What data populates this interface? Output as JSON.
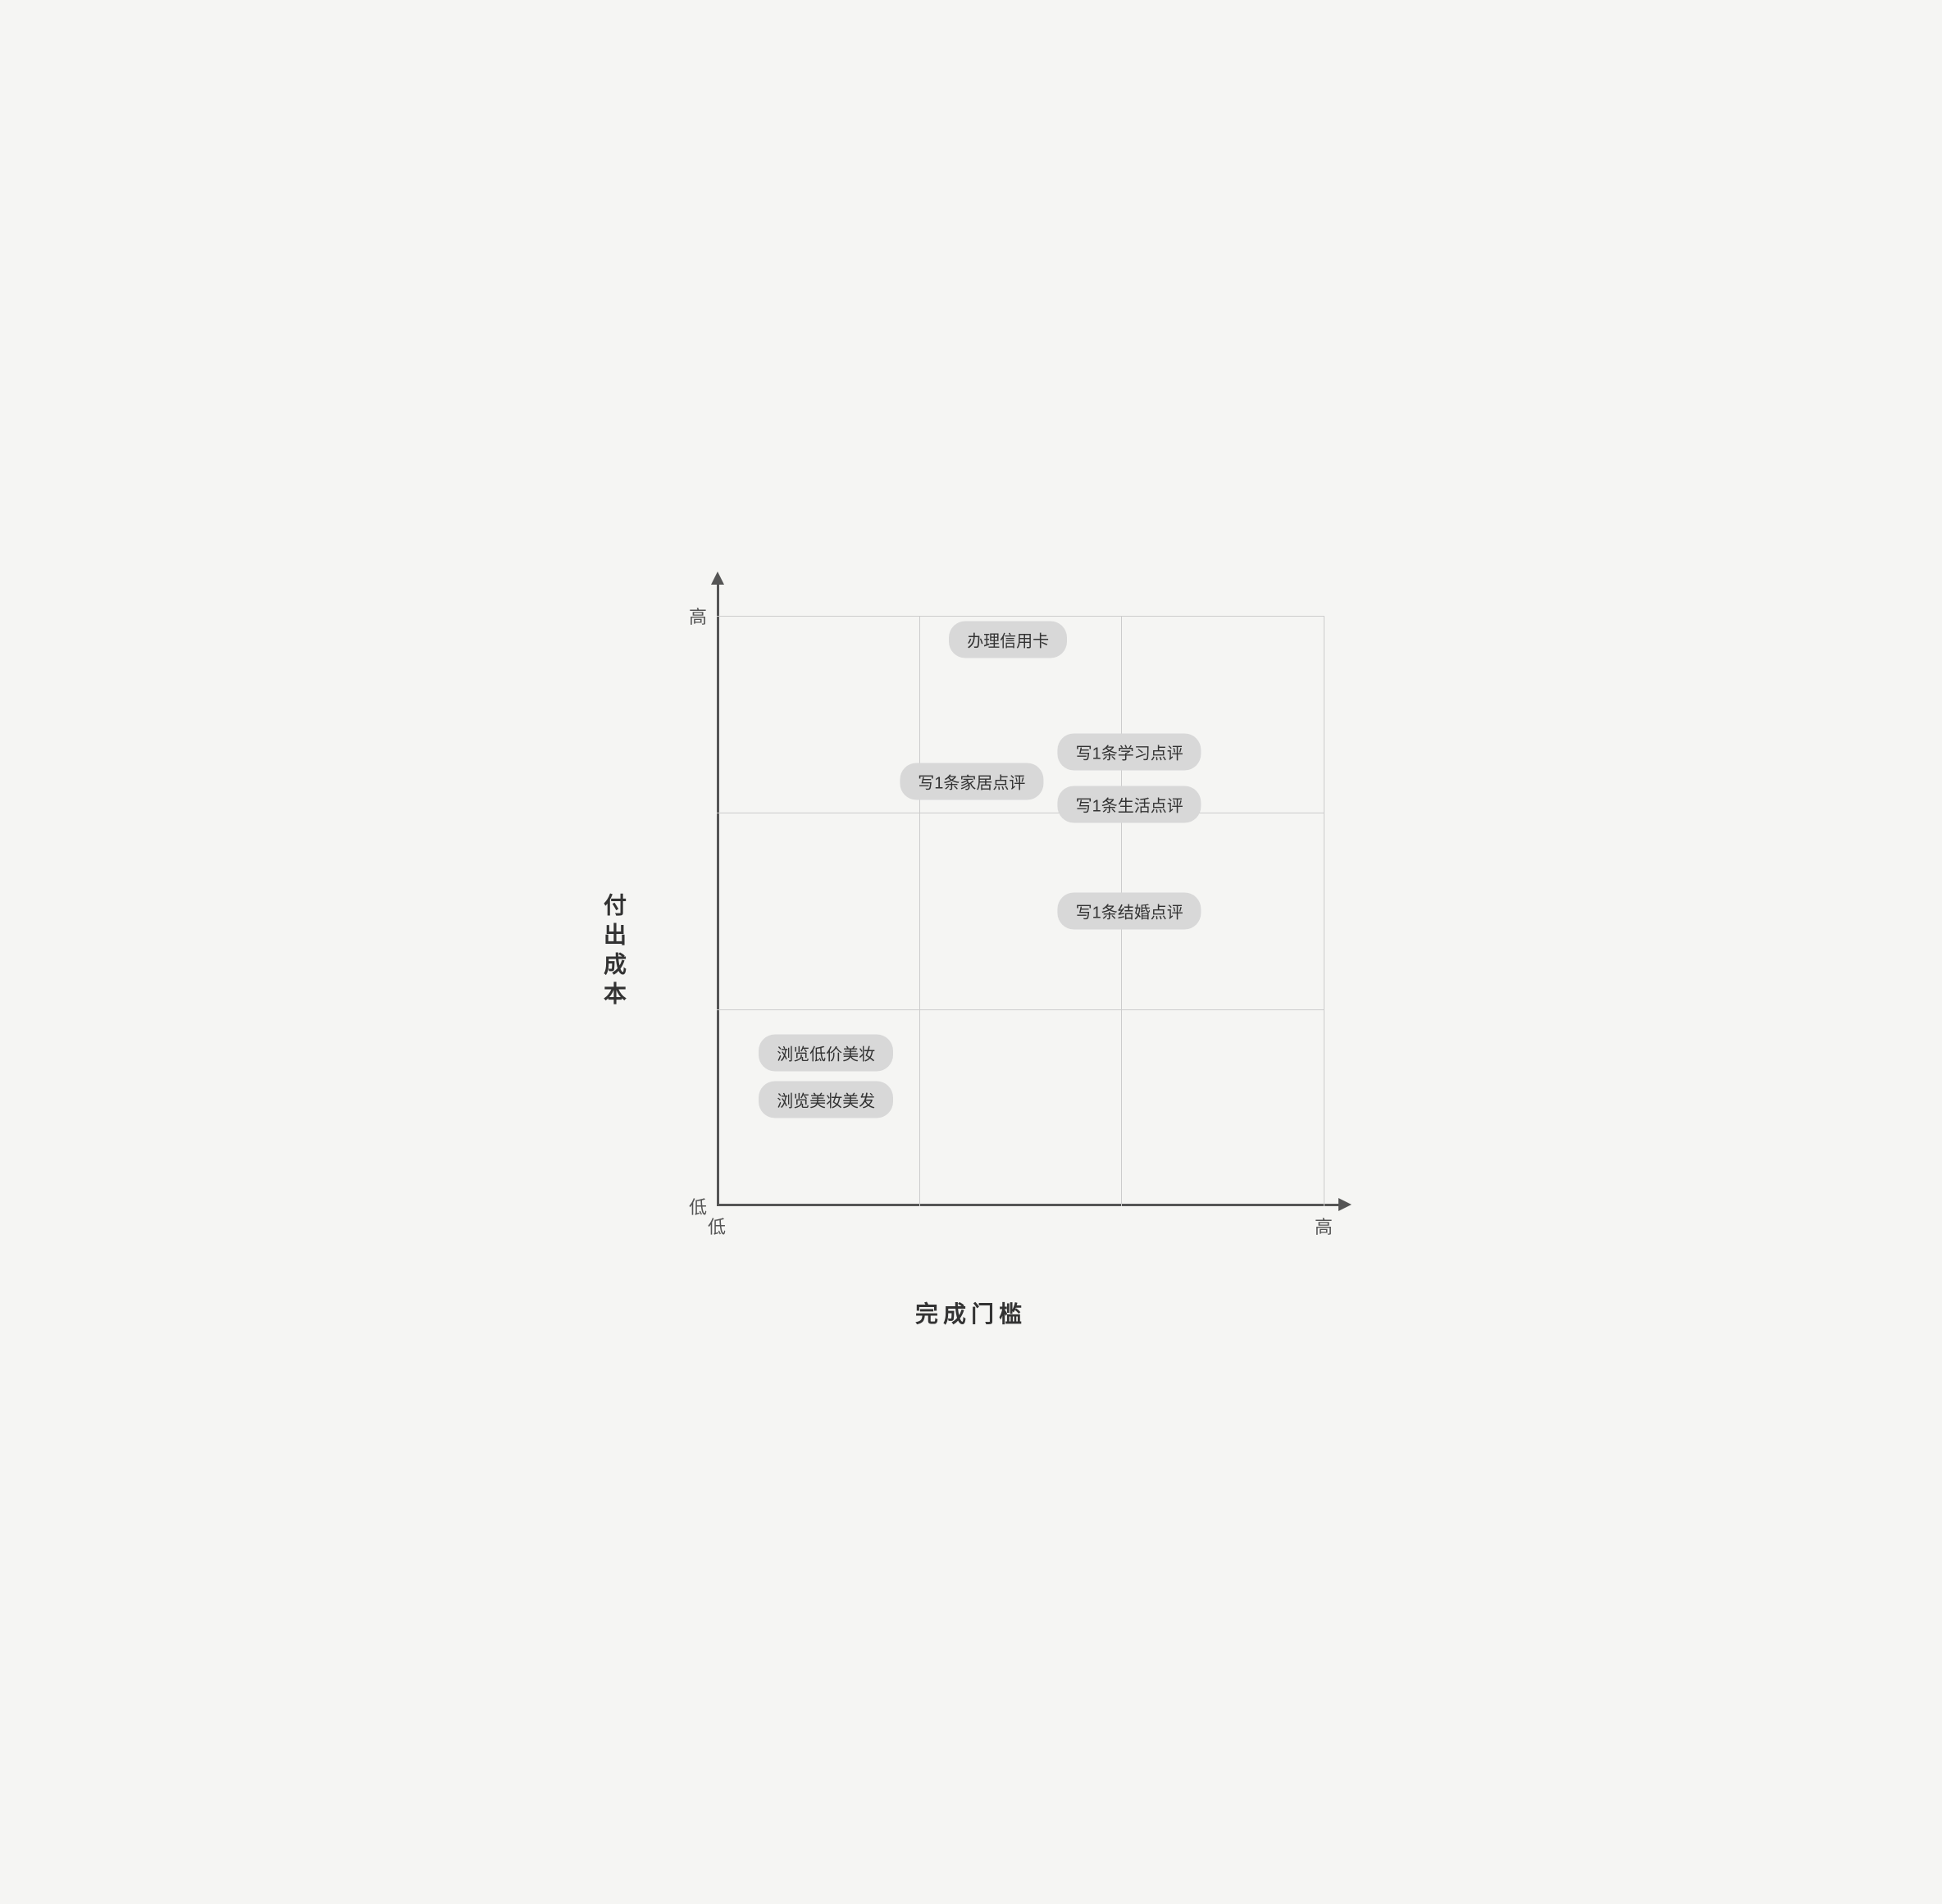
{
  "chart": {
    "y_axis_label": "付出成本",
    "x_axis_label": "完成门槛",
    "label_high_y": "高",
    "label_low_y": "低",
    "label_low_x": "低",
    "label_high_x": "高",
    "tags": [
      {
        "id": "tag-credit-card",
        "text": "办理信用卡",
        "x_pct": 48,
        "y_pct": 96
      },
      {
        "id": "tag-home-review",
        "text": "写1条家居点评",
        "x_pct": 42,
        "y_pct": 72
      },
      {
        "id": "tag-study-review",
        "text": "写1条学习点评",
        "x_pct": 68,
        "y_pct": 77
      },
      {
        "id": "tag-life-review",
        "text": "写1条生活点评",
        "x_pct": 68,
        "y_pct": 68
      },
      {
        "id": "tag-wedding-review",
        "text": "写1条结婚点评",
        "x_pct": 68,
        "y_pct": 50
      },
      {
        "id": "tag-cheap-makeup",
        "text": "浏览低价美妆",
        "x_pct": 18,
        "y_pct": 26
      },
      {
        "id": "tag-makeup-hair",
        "text": "浏览美妆美发",
        "x_pct": 18,
        "y_pct": 18
      }
    ]
  }
}
